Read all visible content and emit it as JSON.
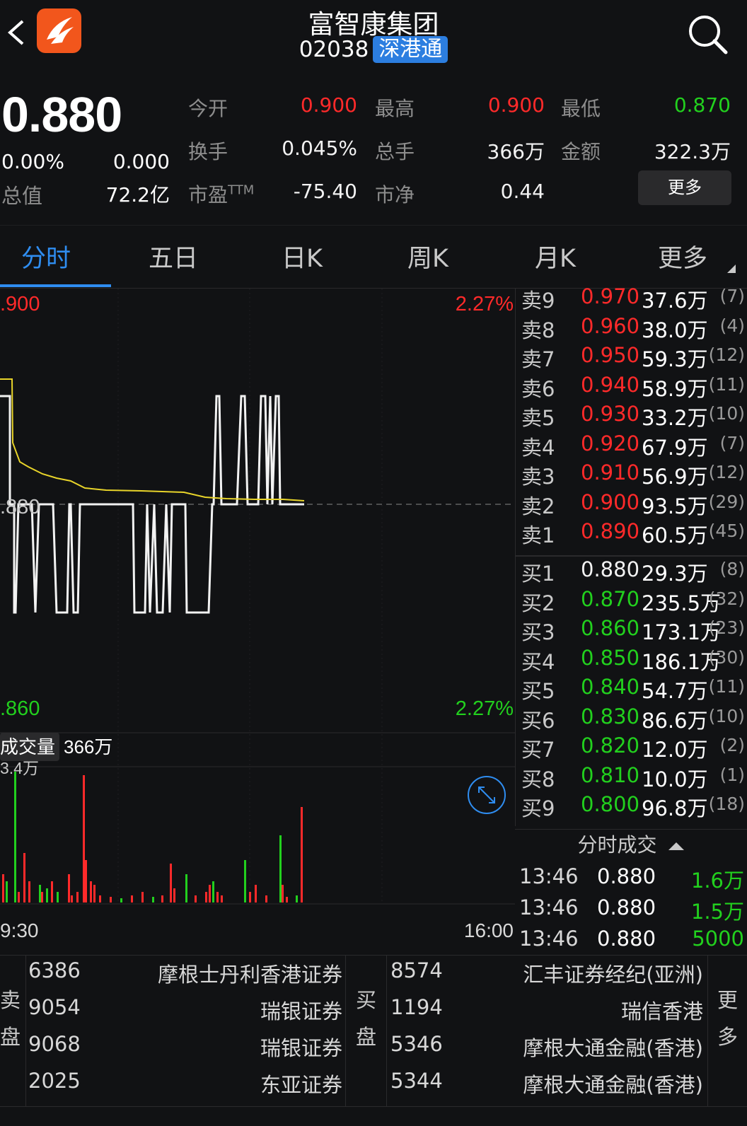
{
  "header": {
    "title": "富智康集团",
    "code": "02038",
    "badge": "深港通"
  },
  "quote": {
    "price": "0.880",
    "change_pct": "0.00%",
    "change_val": "0.000",
    "mktcap_label": "总值",
    "mktcap": "72.2亿",
    "open_label": "今开",
    "open": "0.900",
    "high_label": "最高",
    "high": "0.900",
    "low_label": "最低",
    "low": "0.870",
    "turnover_label": "换手",
    "turnover": "0.045%",
    "volume_label": "总手",
    "volume": "366万",
    "amount_label": "金额",
    "amount": "322.3万",
    "pe_label": "市盈",
    "pe_sup": "TTM",
    "pe": "-75.40",
    "pb_label": "市净",
    "pb": "0.44",
    "more": "更多"
  },
  "tabs": [
    "分时",
    "五日",
    "日K",
    "周K",
    "月K",
    "更多"
  ],
  "chart": {
    "price_top": ".900",
    "price_mid": ".880",
    "price_bottom": ".860",
    "pct_top": "2.27%",
    "pct_bottom": "2.27%",
    "volume_label": "成交量",
    "volume_value": "366万",
    "volume_max": "3.4万",
    "time_start": "9:30",
    "time_end": "16:00"
  },
  "chart_data": {
    "type": "line",
    "series": [
      {
        "values": [
          0.889,
          0.889,
          0.884,
          0.884,
          0.882,
          0.882,
          0.881,
          0.881,
          0.88,
          0.88,
          0.88,
          0.88,
          0.88,
          0.88,
          0.88
        ]
      },
      {
        "values": [
          0.88,
          0.88,
          0.88,
          0.88,
          0.88,
          0.88,
          0.88,
          0.88,
          0.88,
          0.88,
          0.88,
          0.88,
          0.88,
          0.88,
          0.88
        ]
      }
    ],
    "ylim": [
      0.86,
      0.9
    ]
  },
  "book": {
    "asks": [
      {
        "lvl": "卖9",
        "price": "0.970",
        "vol": "37.6万",
        "cnt": "(7)"
      },
      {
        "lvl": "卖8",
        "price": "0.960",
        "vol": "38.0万",
        "cnt": "(4)"
      },
      {
        "lvl": "卖7",
        "price": "0.950",
        "vol": "59.3万",
        "cnt": "(12)"
      },
      {
        "lvl": "卖6",
        "price": "0.940",
        "vol": "58.9万",
        "cnt": "(11)"
      },
      {
        "lvl": "卖5",
        "price": "0.930",
        "vol": "33.2万",
        "cnt": "(10)"
      },
      {
        "lvl": "卖4",
        "price": "0.920",
        "vol": "67.9万",
        "cnt": "(7)"
      },
      {
        "lvl": "卖3",
        "price": "0.910",
        "vol": "56.9万",
        "cnt": "(12)"
      },
      {
        "lvl": "卖2",
        "price": "0.900",
        "vol": "93.5万",
        "cnt": "(29)"
      },
      {
        "lvl": "卖1",
        "price": "0.890",
        "vol": "60.5万",
        "cnt": "(45)"
      }
    ],
    "bids": [
      {
        "lvl": "买1",
        "price": "0.880",
        "vol": "29.3万",
        "cnt": "(8)"
      },
      {
        "lvl": "买2",
        "price": "0.870",
        "vol": "235.5万",
        "cnt": "(32)"
      },
      {
        "lvl": "买3",
        "price": "0.860",
        "vol": "173.1万",
        "cnt": "(23)"
      },
      {
        "lvl": "买4",
        "price": "0.850",
        "vol": "186.1万",
        "cnt": "(30)"
      },
      {
        "lvl": "买5",
        "price": "0.840",
        "vol": "54.7万",
        "cnt": "(11)"
      },
      {
        "lvl": "买6",
        "price": "0.830",
        "vol": "86.6万",
        "cnt": "(10)"
      },
      {
        "lvl": "买7",
        "price": "0.820",
        "vol": "12.0万",
        "cnt": "(2)"
      },
      {
        "lvl": "买8",
        "price": "0.810",
        "vol": "10.0万",
        "cnt": "(1)"
      },
      {
        "lvl": "买9",
        "price": "0.800",
        "vol": "96.8万",
        "cnt": "(18)"
      }
    ]
  },
  "trades": {
    "header": "分时成交",
    "rows": [
      {
        "time": "13:46",
        "price": "0.880",
        "vol": "1.6万"
      },
      {
        "time": "13:46",
        "price": "0.880",
        "vol": "1.5万"
      },
      {
        "time": "13:46",
        "price": "0.880",
        "vol": "5000"
      }
    ]
  },
  "brokers": {
    "sell_label_1": "卖",
    "sell_label_2": "盘",
    "buy_label_1": "买",
    "buy_label_2": "盘",
    "more_1": "更",
    "more_2": "多",
    "sell": [
      {
        "id": "6386",
        "name": "摩根士丹利香港证券"
      },
      {
        "id": "9054",
        "name": "瑞银证券"
      },
      {
        "id": "9068",
        "name": "瑞银证券"
      },
      {
        "id": "2025",
        "name": "东亚证券"
      }
    ],
    "buy": [
      {
        "id": "8574",
        "name": "汇丰证券经纪(亚洲)"
      },
      {
        "id": "1194",
        "name": "瑞信香港"
      },
      {
        "id": "5346",
        "name": "摩根大通金融(香港)"
      },
      {
        "id": "5344",
        "name": "摩根大通金融(香港)"
      }
    ]
  },
  "colors": {
    "up": "#ff2a2a",
    "down": "#22d01e",
    "accent": "#2f8df0",
    "avg_line": "#e8d42a"
  }
}
